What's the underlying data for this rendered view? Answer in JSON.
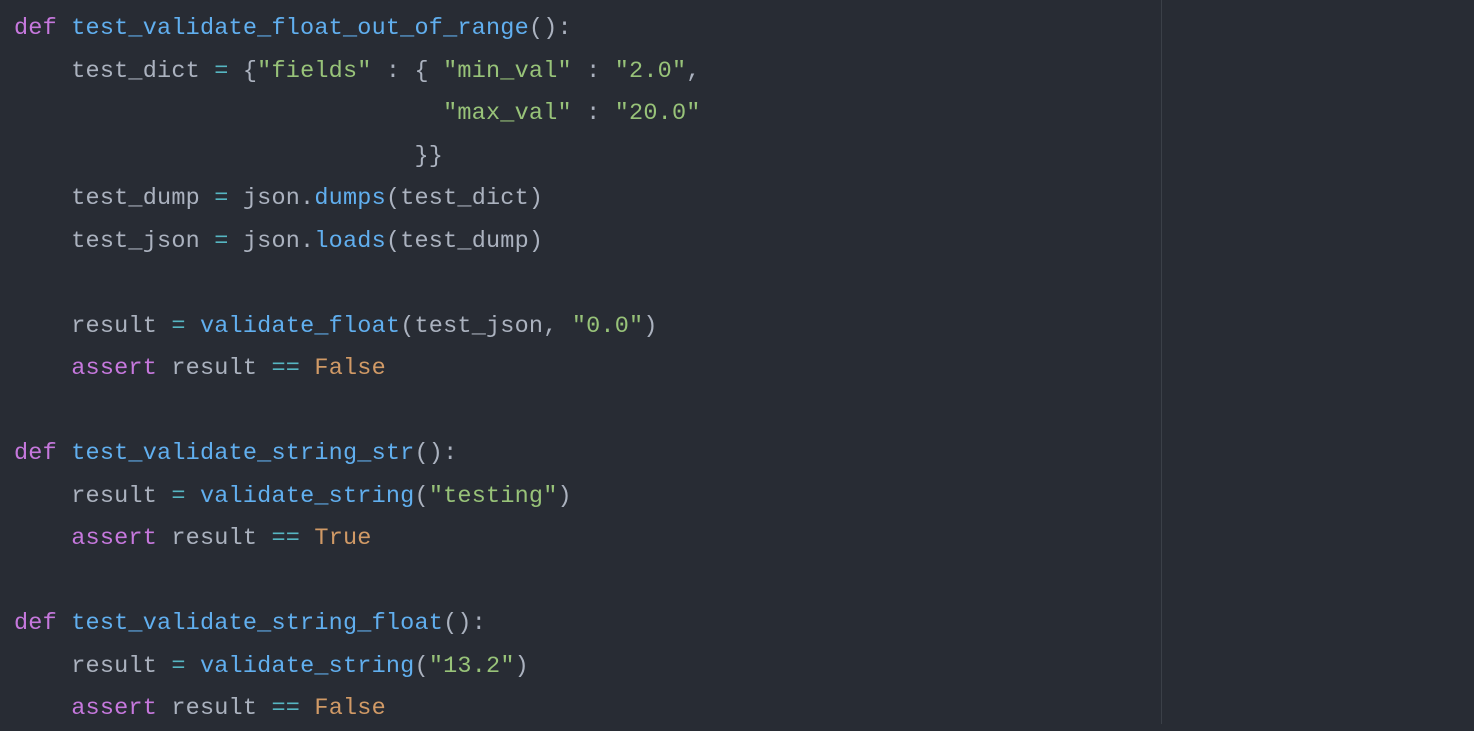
{
  "code": {
    "lines": [
      [
        {
          "t": "def ",
          "c": "kw"
        },
        {
          "t": "test_validate_float_out_of_range",
          "c": "fn"
        },
        {
          "t": "():",
          "c": "pun"
        }
      ],
      [
        {
          "t": "    test_dict ",
          "c": "id"
        },
        {
          "t": "=",
          "c": "op"
        },
        {
          "t": " {",
          "c": "pun"
        },
        {
          "t": "\"fields\"",
          "c": "str"
        },
        {
          "t": " : { ",
          "c": "pun"
        },
        {
          "t": "\"min_val\"",
          "c": "str"
        },
        {
          "t": " : ",
          "c": "pun"
        },
        {
          "t": "\"2.0\"",
          "c": "str"
        },
        {
          "t": ",",
          "c": "pun"
        }
      ],
      [
        {
          "t": "                              ",
          "c": "pun"
        },
        {
          "t": "\"max_val\"",
          "c": "str"
        },
        {
          "t": " : ",
          "c": "pun"
        },
        {
          "t": "\"20.0\"",
          "c": "str"
        }
      ],
      [
        {
          "t": "                            }}",
          "c": "pun"
        }
      ],
      [
        {
          "t": "    test_dump ",
          "c": "id"
        },
        {
          "t": "=",
          "c": "op"
        },
        {
          "t": " json.",
          "c": "id"
        },
        {
          "t": "dumps",
          "c": "fn"
        },
        {
          "t": "(test_dict)",
          "c": "pun"
        }
      ],
      [
        {
          "t": "    test_json ",
          "c": "id"
        },
        {
          "t": "=",
          "c": "op"
        },
        {
          "t": " json.",
          "c": "id"
        },
        {
          "t": "loads",
          "c": "fn"
        },
        {
          "t": "(test_dump)",
          "c": "pun"
        }
      ],
      [
        {
          "t": " ",
          "c": "pun"
        }
      ],
      [
        {
          "t": "    result ",
          "c": "id"
        },
        {
          "t": "=",
          "c": "op"
        },
        {
          "t": " ",
          "c": "pun"
        },
        {
          "t": "validate_float",
          "c": "fn"
        },
        {
          "t": "(test_json, ",
          "c": "pun"
        },
        {
          "t": "\"0.0\"",
          "c": "str"
        },
        {
          "t": ")",
          "c": "pun"
        }
      ],
      [
        {
          "t": "    ",
          "c": "pun"
        },
        {
          "t": "assert",
          "c": "kw"
        },
        {
          "t": " result ",
          "c": "id"
        },
        {
          "t": "==",
          "c": "op"
        },
        {
          "t": " ",
          "c": "pun"
        },
        {
          "t": "False",
          "c": "const"
        }
      ],
      [
        {
          "t": " ",
          "c": "pun"
        }
      ],
      [
        {
          "t": "def ",
          "c": "kw"
        },
        {
          "t": "test_validate_string_str",
          "c": "fn"
        },
        {
          "t": "():",
          "c": "pun"
        }
      ],
      [
        {
          "t": "    result ",
          "c": "id"
        },
        {
          "t": "=",
          "c": "op"
        },
        {
          "t": " ",
          "c": "pun"
        },
        {
          "t": "validate_string",
          "c": "fn"
        },
        {
          "t": "(",
          "c": "pun"
        },
        {
          "t": "\"testing\"",
          "c": "str"
        },
        {
          "t": ")",
          "c": "pun"
        }
      ],
      [
        {
          "t": "    ",
          "c": "pun"
        },
        {
          "t": "assert",
          "c": "kw"
        },
        {
          "t": " result ",
          "c": "id"
        },
        {
          "t": "==",
          "c": "op"
        },
        {
          "t": " ",
          "c": "pun"
        },
        {
          "t": "True",
          "c": "const"
        }
      ],
      [
        {
          "t": " ",
          "c": "pun"
        }
      ],
      [
        {
          "t": "def ",
          "c": "kw"
        },
        {
          "t": "test_validate_string_float",
          "c": "fn"
        },
        {
          "t": "():",
          "c": "pun"
        }
      ],
      [
        {
          "t": "    result ",
          "c": "id"
        },
        {
          "t": "=",
          "c": "op"
        },
        {
          "t": " ",
          "c": "pun"
        },
        {
          "t": "validate_string",
          "c": "fn"
        },
        {
          "t": "(",
          "c": "pun"
        },
        {
          "t": "\"13.2\"",
          "c": "str"
        },
        {
          "t": ")",
          "c": "pun"
        }
      ],
      [
        {
          "t": "    ",
          "c": "pun"
        },
        {
          "t": "assert",
          "c": "kw"
        },
        {
          "t": " result ",
          "c": "id"
        },
        {
          "t": "==",
          "c": "op"
        },
        {
          "t": " ",
          "c": "pun"
        },
        {
          "t": "False",
          "c": "const"
        }
      ]
    ]
  },
  "colors": {
    "background": "#282c34",
    "foreground": "#abb2bf",
    "keyword": "#c678dd",
    "function": "#61afef",
    "operator": "#56b6c2",
    "string": "#98c379",
    "constant": "#d19a66",
    "ruler": "#3b4048"
  }
}
